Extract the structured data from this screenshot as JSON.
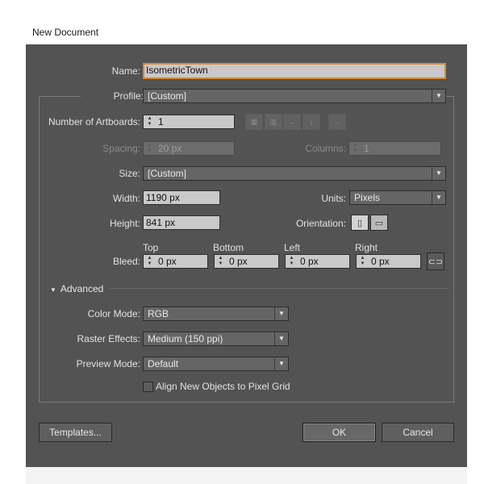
{
  "window": {
    "title": "New Document"
  },
  "name": {
    "label": "Name:",
    "value": "IsometricTown"
  },
  "profile": {
    "label": "Profile:",
    "value": "[Custom]"
  },
  "artboards": {
    "label": "Number of Artboards:",
    "value": "1"
  },
  "spacing": {
    "label": "Spacing:",
    "value": "20 px"
  },
  "columns": {
    "label": "Columns:",
    "value": "1"
  },
  "size": {
    "label": "Size:",
    "value": "[Custom]"
  },
  "width": {
    "label": "Width:",
    "value": "1190 px"
  },
  "units": {
    "label": "Units:",
    "value": "Pixels"
  },
  "height": {
    "label": "Height:",
    "value": "841 px"
  },
  "orientation": {
    "label": "Orientation:",
    "selected": "portrait"
  },
  "bleed": {
    "label": "Bleed:",
    "top": {
      "label": "Top",
      "value": "0 px"
    },
    "bottom": {
      "label": "Bottom",
      "value": "0 px"
    },
    "left": {
      "label": "Left",
      "value": "0 px"
    },
    "right": {
      "label": "Right",
      "value": "0 px"
    }
  },
  "advanced": {
    "label": "Advanced",
    "color_mode": {
      "label": "Color Mode:",
      "value": "RGB"
    },
    "raster_effects": {
      "label": "Raster Effects:",
      "value": "Medium (150 ppi)"
    },
    "preview_mode": {
      "label": "Preview Mode:",
      "value": "Default"
    },
    "pixel_grid": {
      "label": "Align New Objects to Pixel Grid",
      "checked": false
    }
  },
  "buttons": {
    "templates": "Templates...",
    "ok": "OK",
    "cancel": "Cancel"
  },
  "colors": {
    "dialog_bg": "#535353",
    "field_bg": "#c9c9c9",
    "focus": "#d8892f"
  }
}
